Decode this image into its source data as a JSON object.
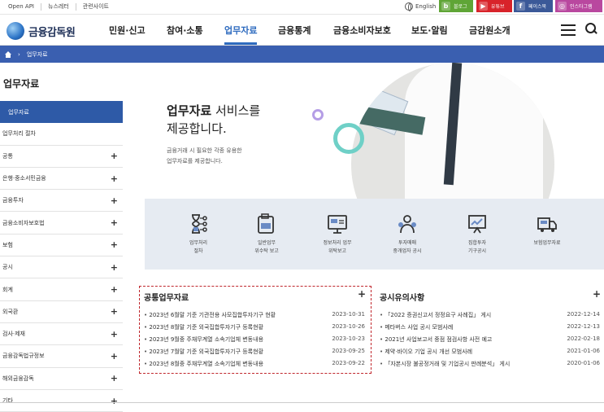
{
  "topbar": {
    "links": [
      "Open API",
      "뉴스레터",
      "관련사이트"
    ],
    "language": "English",
    "sns": [
      {
        "label": "블로그",
        "icon_text": "b",
        "color": "#5fa536"
      },
      {
        "label": "유튜브",
        "icon_text": "▶",
        "color": "#d8232a"
      },
      {
        "label": "페이스북",
        "icon_text": "f",
        "color": "#3b5998"
      },
      {
        "label": "인스타그램",
        "icon_text": "◎",
        "color": "#b9489f"
      }
    ]
  },
  "header": {
    "logo_text": "금융감독원",
    "menu": [
      "민원·신고",
      "참여·소통",
      "업무자료",
      "금융통계",
      "금융소비자보호",
      "보도·알림",
      "금감원소개"
    ],
    "active_menu": "업무자료"
  },
  "breadcrumb": {
    "current": "업무자료"
  },
  "sidebar": {
    "title": "업무자료",
    "items": [
      {
        "label": "업무자료",
        "active": true,
        "expand": ""
      },
      {
        "label": "업무처리 절차",
        "expand": ""
      },
      {
        "label": "공통",
        "expand": "+"
      },
      {
        "label": "은행·중소서민금융",
        "expand": "+"
      },
      {
        "label": "금융투자",
        "expand": "+"
      },
      {
        "label": "금융소비자보호법",
        "expand": "+"
      },
      {
        "label": "보험",
        "expand": "+"
      },
      {
        "label": "공시",
        "expand": "+"
      },
      {
        "label": "회계",
        "expand": "+"
      },
      {
        "label": "외국환",
        "expand": "+"
      },
      {
        "label": "검사·제재",
        "expand": "+"
      },
      {
        "label": "금융감독법규정보",
        "expand": "+"
      },
      {
        "label": "해외금융감독",
        "expand": "+"
      },
      {
        "label": "기타",
        "expand": "+"
      }
    ]
  },
  "hero": {
    "title_bold": "업무자료",
    "title_rest": " 서비스를",
    "title_line2": "제공합니다.",
    "desc_line1": "금융거래 시 필요한 각종 유용한",
    "desc_line2": "업무자료를 제공합니다."
  },
  "services": [
    {
      "line1": "업무처리",
      "line2": "절차",
      "icon": "hourglass-flow-icon"
    },
    {
      "line1": "일반업무",
      "line2": "위수탁 보고",
      "icon": "document-report-icon"
    },
    {
      "line1": "정보처리 업무",
      "line2": "위탁보고",
      "icon": "monitor-icon"
    },
    {
      "line1": "투자매매",
      "line2": "중개업자 공시",
      "icon": "investor-icon"
    },
    {
      "line1": "집합투자",
      "line2": "기구공시",
      "icon": "chart-board-icon"
    },
    {
      "line1": "보험업무자료",
      "line2": "",
      "icon": "insurance-truck-icon"
    }
  ],
  "common_board": {
    "title": "공통업무자료",
    "add": "+",
    "rows": [
      {
        "title": "2023년 6월말 기준 기관전용 사모집합투자기구 현황",
        "date": "2023-10-31"
      },
      {
        "title": "2023년 8월말 기준 외국집합투자기구 등록현황",
        "date": "2023-10-26"
      },
      {
        "title": "2023년 9월중 주채무계열 소속기업체 변동내용",
        "date": "2023-10-23"
      },
      {
        "title": "2023년 7월말 기준 외국집합투자기구 등록현황",
        "date": "2023-09-25"
      },
      {
        "title": "2023년 8월중 주채무계열 소속기업체 변동내용",
        "date": "2023-09-22"
      }
    ]
  },
  "notice_board": {
    "title": "공시유의사항",
    "add": "+",
    "rows": [
      {
        "title": "「2022 증권신고서 정정요구 사례집」 게시",
        "date": "2022-12-14"
      },
      {
        "title": "메타버스 사업 공시 모범사례",
        "date": "2022-12-13"
      },
      {
        "title": "2021년 사업보고서 중점 점검사항 사전 예고",
        "date": "2022-02-18"
      },
      {
        "title": "제약·바이오 기업 공시 개선 모범사례",
        "date": "2021-01-06"
      },
      {
        "title": "「자본시장 불공정거래 및 기업공시 판례분석」 게시",
        "date": "2020-01-06"
      }
    ]
  }
}
